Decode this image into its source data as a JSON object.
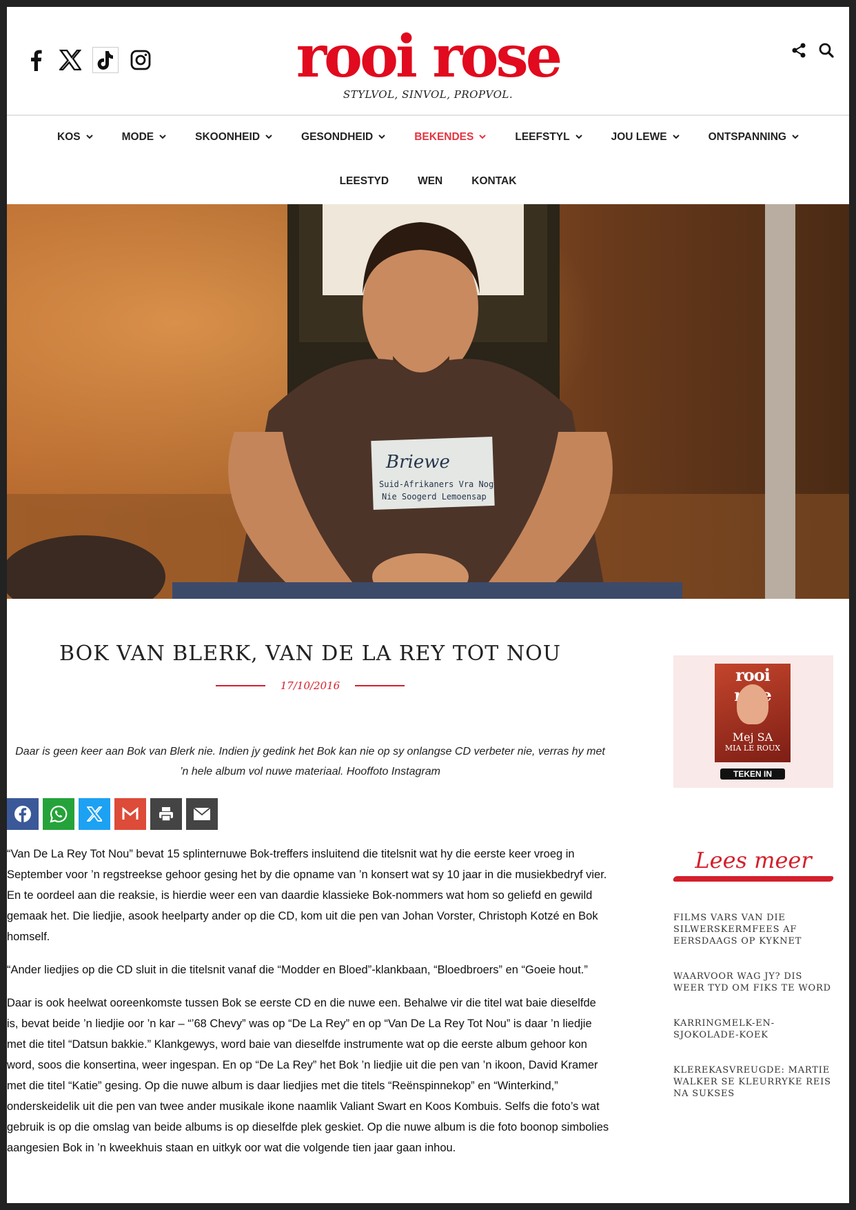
{
  "brand": {
    "logo_text": "rooi rose",
    "tagline": "STYLVOL, SINVOL, PROPVOL.",
    "accent": "#e10a1e"
  },
  "social_icons": [
    "facebook-icon",
    "x-icon",
    "tiktok-icon",
    "instagram-icon"
  ],
  "tools": [
    "share-icon",
    "search-icon"
  ],
  "nav": {
    "row1": [
      {
        "label": "KOS",
        "active": false
      },
      {
        "label": "MODE",
        "active": false
      },
      {
        "label": "SKOONHEID",
        "active": false
      },
      {
        "label": "GESONDHEID",
        "active": false
      },
      {
        "label": "BEKENDES",
        "active": true
      },
      {
        "label": "LEEFSTYL",
        "active": false
      },
      {
        "label": "JOU LEWE",
        "active": false
      },
      {
        "label": "ONTSPANNING",
        "active": false
      }
    ],
    "row2": [
      {
        "label": "LEESTYD"
      },
      {
        "label": "WEN"
      },
      {
        "label": "KONTAK"
      }
    ]
  },
  "hero": {
    "shirt_text_1": "Briewe",
    "shirt_text_2": "Suid-Afrikaners Vra Nog",
    "shirt_text_3": "Nie Soogerd Lemoensap"
  },
  "article": {
    "title": "BOK VAN BLERK, VAN DE LA REY TOT NOU",
    "date": "17/10/2016",
    "intro": "Daar is geen keer aan Bok van Blerk nie. Indien jy gedink het Bok kan nie op sy onlangse CD verbeter nie, verras hy met ’n hele album vol nuwe materiaal. Hooffoto Instagram",
    "paragraphs": [
      "“Van De La Rey Tot Nou” bevat 15 splinternuwe Bok-treffers insluitend die titelsnit wat hy die eerste keer vroeg in September voor ’n regstreekse gehoor gesing het by die opname van ’n konsert wat sy 10 jaar in die musiekbedryf vier. En te oordeel aan die reaksie, is hierdie weer een van daardie klassieke Bok-nommers wat hom so geliefd en gewild gemaak het. Die liedjie, asook heelparty ander op die CD, kom uit die pen van Johan Vorster, Christoph Kotzé en Bok homself.",
      "“Ander liedjies op die CD sluit in die titelsnit vanaf die “Modder en Bloed”-klankbaan, “Bloedbroers” en “Goeie hout.”",
      "Daar is ook heelwat ooreenkomste tussen Bok se eerste CD en die nuwe een. Behalwe vir die titel wat baie dieselfde is, bevat beide ’n liedjie oor ’n kar – “’68 Chevy” was op “De La Rey” en op “Van De La Rey Tot Nou” is daar ’n liedjie met die titel “Datsun bakkie.” Klankgewys, word baie van dieselfde instrumente wat op die eerste album gehoor kon word, soos die konsertina, weer ingespan. En op “De La Rey” het Bok ’n liedjie uit die pen van ’n ikoon, David Kramer met die titel “Katie” gesing. Op die nuwe album is daar liedjies met die titels “Reënspinnekop” en “Winterkind,” onderskeidelik uit die pen van twee ander musikale ikone naamlik Valiant Swart en Koos Kombuis. Selfs die foto’s wat gebruik is op die omslag van beide albums is op dieselfde plek geskiet. Op die nuwe album is die foto boonop simbolies aangesien Bok in ’n kweekhuis staan en uitkyk oor wat die volgende tien jaar gaan inhou."
    ]
  },
  "share_buttons": [
    {
      "name": "facebook-share-button",
      "color": "#3b5998"
    },
    {
      "name": "whatsapp-share-button",
      "color": "#25a33a"
    },
    {
      "name": "x-share-button",
      "color": "#1da1f2"
    },
    {
      "name": "gmail-share-button",
      "color": "#dd4b39"
    },
    {
      "name": "print-share-button",
      "color": "#444444"
    },
    {
      "name": "email-share-button",
      "color": "#444444"
    }
  ],
  "sidebar": {
    "magazine": {
      "title": "rooi rose",
      "cover_line": "MIA LE ROUX",
      "cover_headline": "Mej SA",
      "subscribe_label": "TEKEN IN"
    },
    "lees_meer": "Lees meer",
    "related": [
      "FILMS VARS VAN DIE SILWERSKERMFEES AF EERSDAAGS OP KYKNET",
      "WAARVOOR WAG JY? DIS WEER TYD OM FIKS TE WORD",
      "KARRINGMELK-EN-SJOKOLADE-KOEK",
      "KLEREKASVREUGDE: MARTIE WALKER SE KLEURRYKE REIS NA SUKSES"
    ]
  }
}
